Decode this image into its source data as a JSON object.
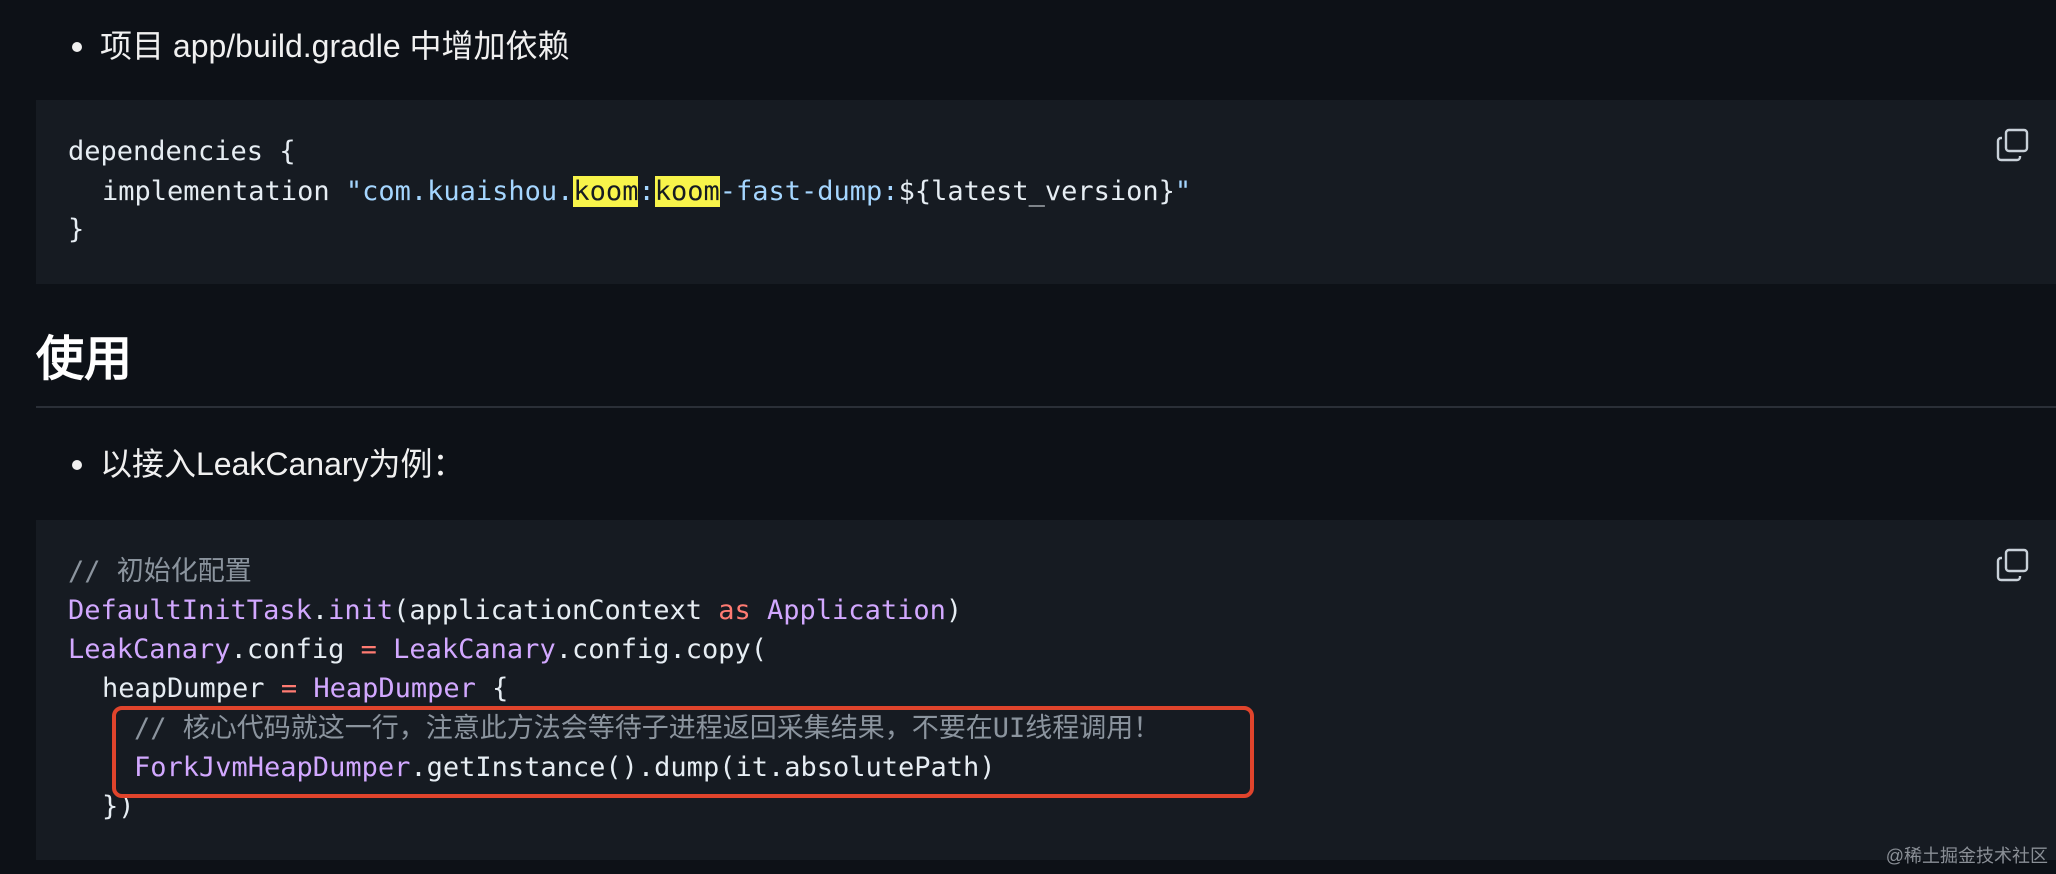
{
  "bullets": [
    {
      "text": "项目 app/build.gradle 中增加依赖"
    },
    {
      "text": "以接入LeakCanary为例："
    }
  ],
  "heading": "使用",
  "code_block_1": {
    "lines": [
      {
        "tokens": [
          {
            "t": "dependencies {",
            "c": "plain"
          }
        ]
      },
      {
        "tokens": [
          {
            "t": "implementation ",
            "c": "plain"
          },
          {
            "t": "\"com.kuaishou.",
            "c": "str"
          },
          {
            "t": "koom",
            "c": "hl"
          },
          {
            "t": ":",
            "c": "str"
          },
          {
            "t": "koom",
            "c": "hl"
          },
          {
            "t": "-fast-dump:",
            "c": "str"
          },
          {
            "t": "${latest_version}",
            "c": "plain"
          },
          {
            "t": "\"",
            "c": "str"
          }
        ]
      },
      {
        "tokens": [
          {
            "t": "}",
            "c": "plain"
          }
        ]
      }
    ]
  },
  "code_block_2": {
    "lines": [
      {
        "tokens": [
          {
            "t": "// 初始化配置",
            "c": "comment"
          }
        ]
      },
      {
        "tokens": [
          {
            "t": "DefaultInitTask",
            "c": "fn"
          },
          {
            "t": ".",
            "c": "plain"
          },
          {
            "t": "init",
            "c": "fn"
          },
          {
            "t": "(applicationContext ",
            "c": "plain"
          },
          {
            "t": "as",
            "c": "kw"
          },
          {
            "t": " ",
            "c": "plain"
          },
          {
            "t": "Application",
            "c": "fn"
          },
          {
            "t": ")",
            "c": "plain"
          }
        ]
      },
      {
        "tokens": [
          {
            "t": "LeakCanary",
            "c": "fn"
          },
          {
            "t": ".config ",
            "c": "plain"
          },
          {
            "t": "=",
            "c": "kw"
          },
          {
            "t": " ",
            "c": "plain"
          },
          {
            "t": "LeakCanary",
            "c": "fn"
          },
          {
            "t": ".config.copy(",
            "c": "plain"
          }
        ]
      },
      {
        "tokens": [
          {
            "t": "heapDumper ",
            "c": "plain"
          },
          {
            "t": "=",
            "c": "kw"
          },
          {
            "t": " ",
            "c": "plain"
          },
          {
            "t": "HeapDumper",
            "c": "fn"
          },
          {
            "t": " {",
            "c": "plain"
          }
        ]
      },
      {
        "tokens": [
          {
            "t": "// 核心代码就这一行，注意此方法会等待子进程返回采集结果，不要在UI线程调用！",
            "c": "comment"
          }
        ]
      },
      {
        "tokens": [
          {
            "t": "ForkJvmHeapDumper",
            "c": "fn"
          },
          {
            "t": ".getInstance().dump(it.absolutePath)",
            "c": "plain"
          }
        ]
      },
      {
        "tokens": [
          {
            "t": "})",
            "c": "plain"
          }
        ]
      }
    ]
  },
  "watermark": "@稀土掘金技术社区",
  "colors": {
    "background": "#0d1117",
    "code_background": "#161b22",
    "string": "#a5d6ff",
    "function": "#d2a8ff",
    "keyword": "#ff7b72",
    "comment": "#8b949e",
    "highlight": "#f8f44a",
    "annotation_box": "#e0442c"
  },
  "icons": {
    "copy": "copy-icon"
  }
}
